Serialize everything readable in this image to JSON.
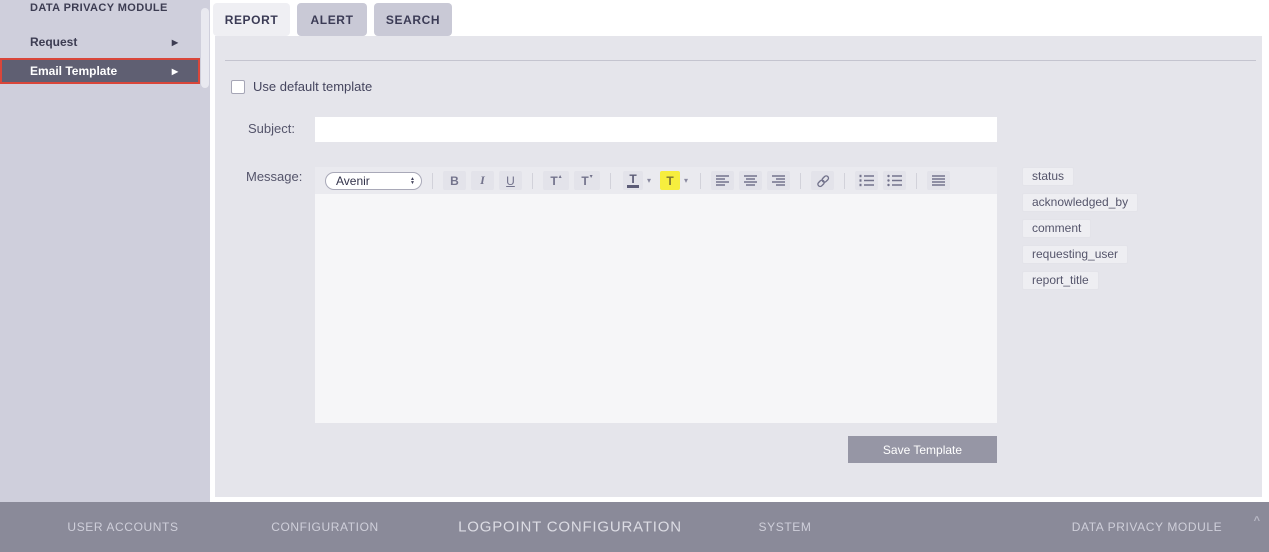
{
  "sidebar": {
    "title": "DATA PRIVACY MODULE",
    "items": [
      {
        "label": "Request"
      },
      {
        "label": "Email Template"
      }
    ]
  },
  "tabs": [
    {
      "label": "REPORT",
      "active": true
    },
    {
      "label": "ALERT",
      "active": false
    },
    {
      "label": "SEARCH",
      "active": false
    }
  ],
  "form": {
    "use_default_label": "Use default template",
    "use_default_checked": false,
    "subject_label": "Subject:",
    "subject_value": "",
    "message_label": "Message:",
    "message_value": "",
    "save_button_label": "Save Template"
  },
  "editor": {
    "font_family_value": "Avenir",
    "buttons": {
      "bold": "B",
      "italic": "I",
      "underline": "U",
      "grow": "T",
      "shrink": "T",
      "text_color": "T",
      "highlight": "T"
    }
  },
  "placeholders": [
    "status",
    "acknowledged_by",
    "comment",
    "requesting_user",
    "report_title"
  ],
  "footer": {
    "items": [
      "USER ACCOUNTS",
      "CONFIGURATION",
      "LOGPOINT CONFIGURATION",
      "SYSTEM",
      "DATA PRIVACY MODULE"
    ]
  },
  "icons": {
    "arrow_right": "▶",
    "caret_down": "▾",
    "step_up": "▲",
    "step_down": "▼",
    "sup_up": "▴",
    "sup_down": "▾",
    "collapse": "^"
  },
  "colors": {
    "accent_red": "#d9463a",
    "selected_item_bg": "#5f5f72",
    "highlight_yellow": "#f6ee3e",
    "sidebar_bg": "#cfcfdc",
    "panel_bg": "#e5e5eb",
    "footer_bg": "#8a8a99",
    "save_button_bg": "#9696a5"
  }
}
